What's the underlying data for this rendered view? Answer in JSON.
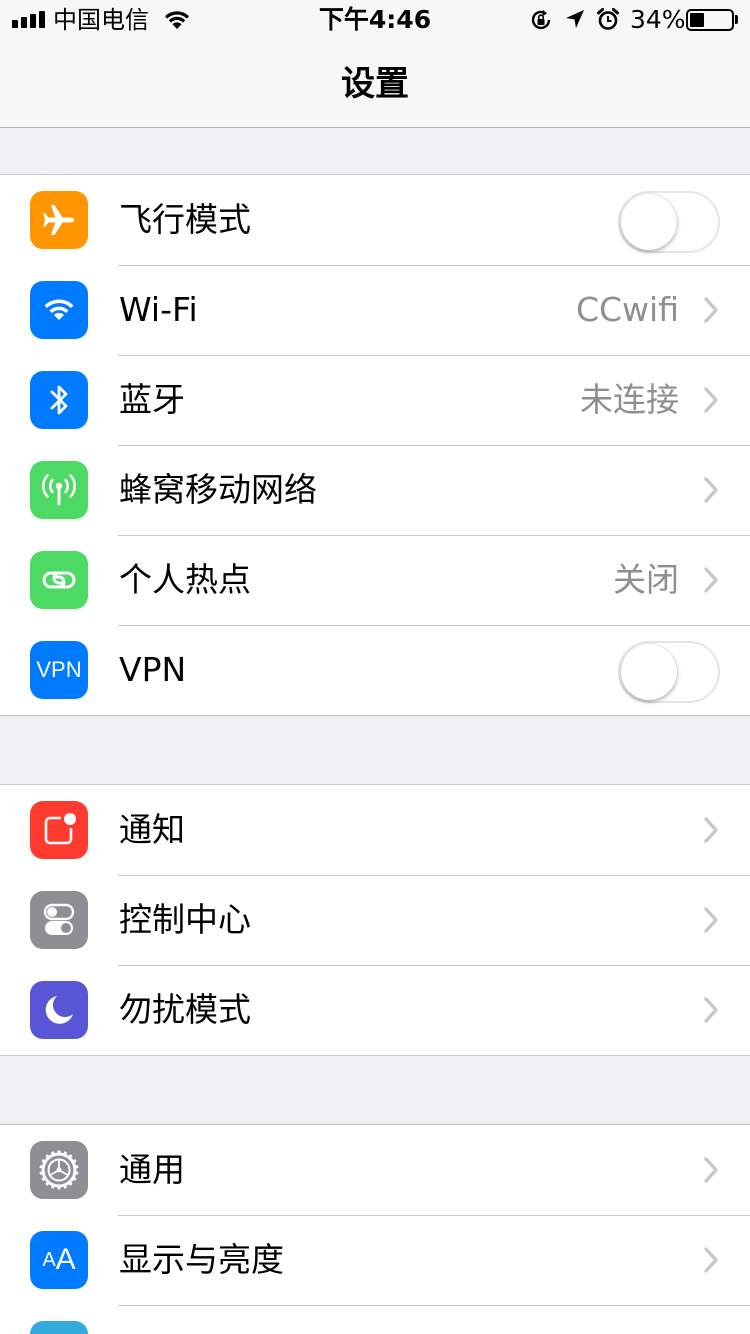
{
  "status_bar": {
    "carrier": "中国电信",
    "time": "下午4:46",
    "battery_percent": "34%",
    "battery_level": 0.34,
    "signal_bars": 4,
    "icons": [
      "signal-icon",
      "wifi-icon",
      "orientation-lock-icon",
      "location-icon",
      "alarm-icon",
      "battery-icon"
    ]
  },
  "nav": {
    "title": "设置"
  },
  "groups": [
    {
      "rows": [
        {
          "icon": "airplane-icon",
          "icon_color": "#ff9500",
          "label": "飞行模式",
          "control": "toggle",
          "on": false
        },
        {
          "icon": "wifi-icon",
          "icon_color": "#007aff",
          "label": "Wi-Fi",
          "value": "CCwifi",
          "control": "chevron"
        },
        {
          "icon": "bluetooth-icon",
          "icon_color": "#007aff",
          "label": "蓝牙",
          "value": "未连接",
          "control": "chevron"
        },
        {
          "icon": "cellular-icon",
          "icon_color": "#4cd964",
          "label": "蜂窝移动网络",
          "control": "chevron"
        },
        {
          "icon": "hotspot-icon",
          "icon_color": "#4cd964",
          "label": "个人热点",
          "value": "关闭",
          "control": "chevron"
        },
        {
          "icon": "vpn-icon",
          "icon_text": "VPN",
          "icon_color": "#007aff",
          "label": "VPN",
          "control": "toggle",
          "on": false
        }
      ]
    },
    {
      "rows": [
        {
          "icon": "notifications-icon",
          "icon_color": "#ff3b30",
          "label": "通知",
          "control": "chevron"
        },
        {
          "icon": "control-center-icon",
          "icon_color": "#8e8e93",
          "label": "控制中心",
          "control": "chevron"
        },
        {
          "icon": "moon-icon",
          "icon_color": "#5856d6",
          "label": "勿扰模式",
          "control": "chevron"
        }
      ]
    },
    {
      "rows": [
        {
          "icon": "gear-icon",
          "icon_color": "#8e8e93",
          "label": "通用",
          "control": "chevron"
        },
        {
          "icon": "display-brightness-icon",
          "icon_text_small": "A",
          "icon_text_big": "A",
          "icon_color": "#007aff",
          "label": "显示与亮度",
          "control": "chevron"
        },
        {
          "icon": "wallpaper-icon",
          "icon_color": "#34aadc",
          "label": "",
          "control": "none"
        }
      ]
    }
  ]
}
